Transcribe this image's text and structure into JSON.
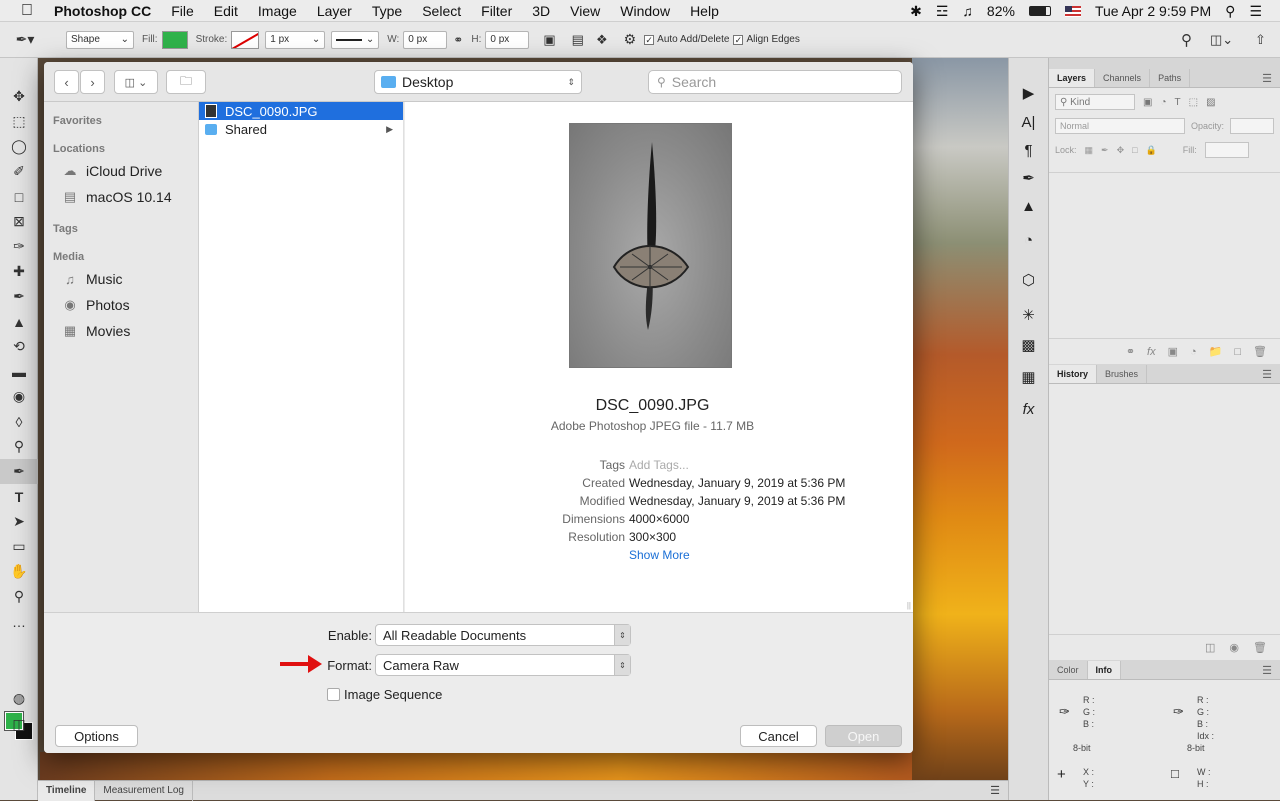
{
  "menubar": {
    "app": "Photoshop CC",
    "items": [
      "File",
      "Edit",
      "Image",
      "Layer",
      "Type",
      "Select",
      "Filter",
      "3D",
      "View",
      "Window",
      "Help"
    ],
    "battery": "82%",
    "datetime": "Tue Apr 2  9:59 PM"
  },
  "options": {
    "mode": "Shape",
    "fill_label": "Fill:",
    "stroke_label": "Stroke:",
    "stroke_size": "1 px",
    "w_label": "W:",
    "w_value": "0 px",
    "h_label": "H:",
    "h_value": "0 px",
    "auto_add": "Auto Add/Delete",
    "align_edges": "Align Edges",
    "fill_color": "#2fb24a"
  },
  "dialog": {
    "location": "Desktop",
    "search_placeholder": "Search",
    "sidebar": {
      "favorites": "Favorites",
      "locations": "Locations",
      "location_items": [
        "iCloud Drive",
        "macOS 10.14"
      ],
      "tags": "Tags",
      "media": "Media",
      "media_items": [
        "Music",
        "Photos",
        "Movies"
      ]
    },
    "files": [
      {
        "name": "DSC_0090.JPG"
      },
      {
        "name": "Shared"
      }
    ],
    "preview": {
      "filename": "DSC_0090.JPG",
      "kind": "Adobe Photoshop JPEG file - 11.7 MB",
      "tags_label": "Tags",
      "tags_value": "Add Tags...",
      "created_label": "Created",
      "created_value": "Wednesday, January 9, 2019 at 5:36 PM",
      "modified_label": "Modified",
      "modified_value": "Wednesday, January 9, 2019 at 5:36 PM",
      "dimensions_label": "Dimensions",
      "dimensions_value": "4000×6000",
      "resolution_label": "Resolution",
      "resolution_value": "300×300",
      "show_more": "Show More"
    },
    "enable_label": "Enable:",
    "enable_value": "All Readable Documents",
    "format_label": "Format:",
    "format_value": "Camera Raw",
    "image_sequence": "Image Sequence",
    "options_button": "Options",
    "cancel_button": "Cancel",
    "open_button": "Open"
  },
  "panels": {
    "layers_tabs": [
      "Layers",
      "Channels",
      "Paths"
    ],
    "kind": "Kind",
    "blend": "Normal",
    "opacity_label": "Opacity:",
    "lock_label": "Lock:",
    "fill_label": "Fill:",
    "history_tabs": [
      "History",
      "Brushes"
    ],
    "info_tabs": [
      "Color",
      "Info"
    ],
    "info": {
      "r": "R :",
      "g": "G :",
      "b": "B :",
      "bit1": "8-bit",
      "bit2": "8-bit",
      "idx": "Idx :",
      "x": "X :",
      "y": "Y :",
      "w": "W :",
      "h": "H :"
    }
  },
  "timeline": [
    "Timeline",
    "Measurement Log"
  ]
}
